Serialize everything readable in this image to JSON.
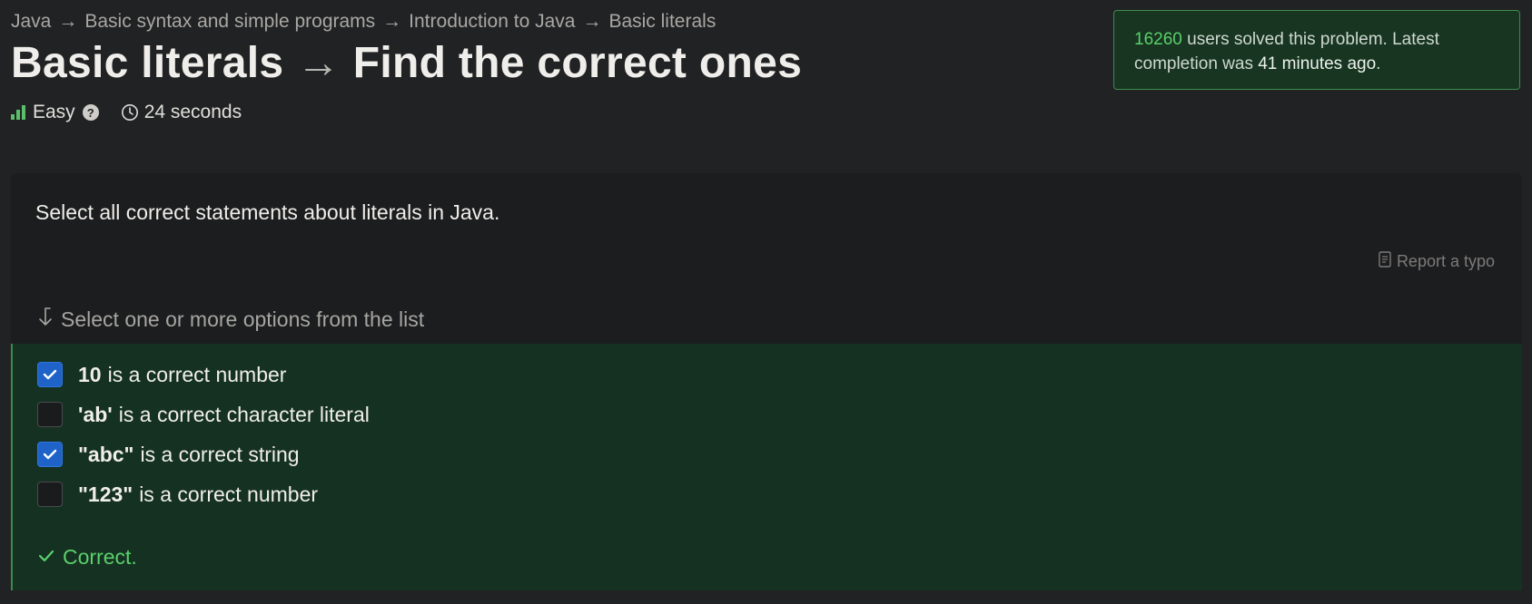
{
  "breadcrumb": {
    "items": [
      "Java",
      "Basic syntax and simple programs",
      "Introduction to Java",
      "Basic literals"
    ],
    "separator": "→"
  },
  "title": {
    "topic": "Basic literals",
    "arrow": "→",
    "problem": "Find the correct ones"
  },
  "meta": {
    "difficulty": "Easy",
    "help_symbol": "?",
    "time": "24 seconds"
  },
  "solved": {
    "count": "16260",
    "text1": "users solved this problem. Latest completion was",
    "time_ago": "41 minutes ago",
    "end": "."
  },
  "question": {
    "text": "Select all correct statements about literals in Java.",
    "report_label": "Report a typo",
    "hint": "Select one or more options from the list"
  },
  "options": [
    {
      "code": "10",
      "text": "is a correct number",
      "checked": true
    },
    {
      "code": "'ab'",
      "text": "is a correct character literal",
      "checked": false
    },
    {
      "code": "\"abc\"",
      "text": "is a correct string",
      "checked": true
    },
    {
      "code": "\"123\"",
      "text": "is a correct number",
      "checked": false
    }
  ],
  "result": {
    "text": "Correct."
  },
  "colors": {
    "accent_green": "#5bd06c",
    "checkbox_blue": "#1f63c9",
    "options_bg": "#153121"
  }
}
